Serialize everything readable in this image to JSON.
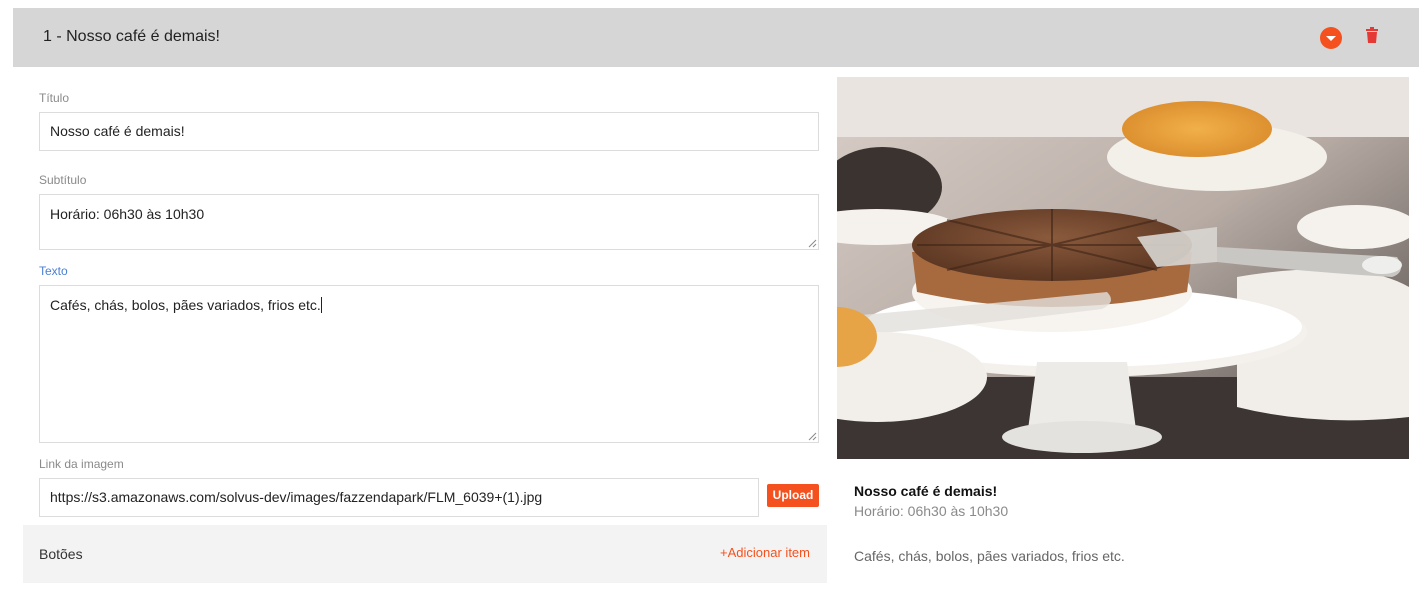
{
  "header": {
    "title": "1 - Nosso café é demais!"
  },
  "form": {
    "titulo_label": "Título",
    "titulo_value": "Nosso café é demais!",
    "subtitulo_label": "Subtítulo",
    "subtitulo_value": "Horário: 06h30 às 10h30",
    "texto_label": "Texto",
    "texto_value": "Cafés, chás, bolos, pães variados, frios etc.",
    "link_label": "Link da imagem",
    "link_value": "https://s3.amazonaws.com/solvus-dev/images/fazzendapark/FLM_6039+(1).jpg",
    "upload_label": "Upload"
  },
  "buttons_section": {
    "title": "Botões",
    "add_label": "+Adicionar item"
  },
  "preview": {
    "title": "Nosso café é demais!",
    "subtitle": "Horário: 06h30 às 10h30",
    "text": "Cafés, chás, bolos, pães variados, frios etc."
  },
  "colors": {
    "accent": "#f4511e",
    "active_label": "#4a7fd6",
    "header_bg": "#d6d6d6"
  },
  "icons": {
    "collapse": "chevron-down-icon",
    "delete": "trash-icon"
  }
}
